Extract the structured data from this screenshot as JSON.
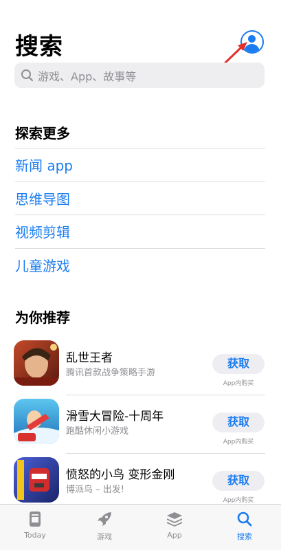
{
  "header": {
    "title": "搜索"
  },
  "search": {
    "placeholder": "游戏、App、故事等"
  },
  "explore": {
    "heading": "探索更多",
    "items": [
      "新闻 app",
      "思维导图",
      "视频剪辑",
      "儿童游戏"
    ]
  },
  "recommend": {
    "heading": "为你推荐",
    "apps": [
      {
        "name": "乱世王者",
        "subtitle": "腾讯首款战争策略手游",
        "button": "获取",
        "note": "App内购买"
      },
      {
        "name": "滑雪大冒险-十周年",
        "subtitle": "跑酷休闲小游戏",
        "button": "获取",
        "note": "App内购买"
      },
      {
        "name": "愤怒的小鸟 变形金刚",
        "subtitle": "博派鸟 – 出发!",
        "button": "获取",
        "note": "App内购买"
      }
    ]
  },
  "tabs": [
    {
      "label": "Today",
      "icon": "today-icon"
    },
    {
      "label": "游戏",
      "icon": "rocket-icon"
    },
    {
      "label": "App",
      "icon": "layers-icon"
    },
    {
      "label": "搜索",
      "icon": "search-icon"
    }
  ],
  "colors": {
    "accent": "#1a7cf0",
    "annotation_arrow": "#e2302a"
  }
}
